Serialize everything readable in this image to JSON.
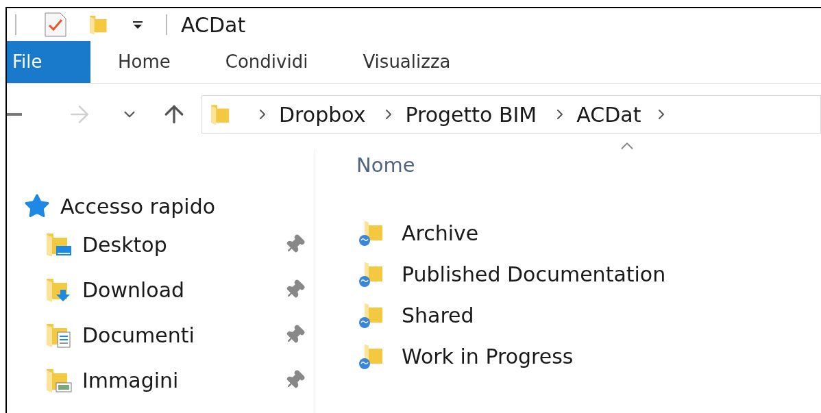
{
  "title_bar": {
    "title": "ACDat"
  },
  "ribbon_tabs": [
    {
      "label": "File",
      "selected": true
    },
    {
      "label": "Home",
      "selected": false
    },
    {
      "label": "Condividi",
      "selected": false
    },
    {
      "label": "Visualizza",
      "selected": false
    }
  ],
  "address_bar": {
    "path": [
      "Dropbox",
      "Progetto BIM",
      "ACDat"
    ]
  },
  "navigation_pane": {
    "header": "Accesso rapido",
    "items": [
      {
        "label": "Desktop",
        "kind": "desktop",
        "pinned": true
      },
      {
        "label": "Download",
        "kind": "download",
        "pinned": true
      },
      {
        "label": "Documenti",
        "kind": "documents",
        "pinned": true
      },
      {
        "label": "Immagini",
        "kind": "pictures",
        "pinned": true
      }
    ]
  },
  "file_list": {
    "column": "Nome",
    "items": [
      {
        "name": "Archive"
      },
      {
        "name": "Published Documentation"
      },
      {
        "name": "Shared"
      },
      {
        "name": "Work in Progress"
      }
    ]
  }
}
